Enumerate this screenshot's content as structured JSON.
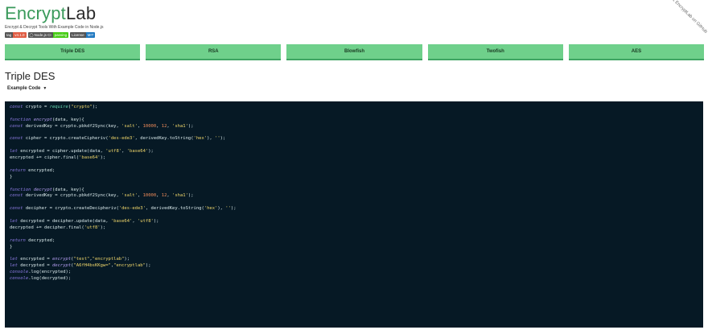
{
  "brand": {
    "part1": "Encrypt",
    "part2": "Lab"
  },
  "tagline": "Encrypt & Decrypt Tools With Example Code in Node.js",
  "badges": [
    {
      "label": "tag",
      "value": "v4.1.0"
    },
    {
      "label": "Node.js CI",
      "value": "passing"
    },
    {
      "label": "License",
      "value": "MIT"
    }
  ],
  "fork_ribbon": "Fork EncryptLab on GitHub",
  "nav": [
    "Triple DES",
    "RSA",
    "Blowfish",
    "Twofish",
    "AES"
  ],
  "section_title": "Triple DES",
  "dropdown": {
    "label": "Example Code",
    "caret": "▼"
  },
  "code_lines": [
    "const crypto = require(\"crypto\");",
    "",
    "function encrypt(data, key){",
    "const derivedKey = crypto.pbkdf2Sync(key, 'salt', 10000, 12, 'sha1');",
    "",
    "const cipher = crypto.createCipheriv('des-ede3', derivedKey.toString('hex'), '');",
    "",
    "let encrypted = cipher.update(data, 'utf8', 'base64');",
    "encrypted += cipher.final('base64');",
    "",
    "return encrypted;",
    "}",
    "",
    "function decrypt(data, key){",
    "const derivedKey = crypto.pbkdf2Sync(key, 'salt', 10000, 12, 'sha1');",
    "",
    "const decipher = crypto.createDecipheriv('des-ede3', derivedKey.toString('hex'), '');",
    "",
    "let decrypted = decipher.update(data, 'base64', 'utf8');",
    "decrypted += decipher.final('utf8');",
    "",
    "return decrypted;",
    "}",
    "",
    "let encrypted = encrypt(\"test\",\"encryptlab\");",
    "let decrypted = decrypt(\"A6fH4bsKKgw=\",\"encryptlab\");",
    "console.log(encrypted);",
    "console.log(decrypted);"
  ],
  "colors": {
    "accent": "#3a9a5b",
    "nav_button": "#6fd08b",
    "code_bg": "#061925"
  }
}
